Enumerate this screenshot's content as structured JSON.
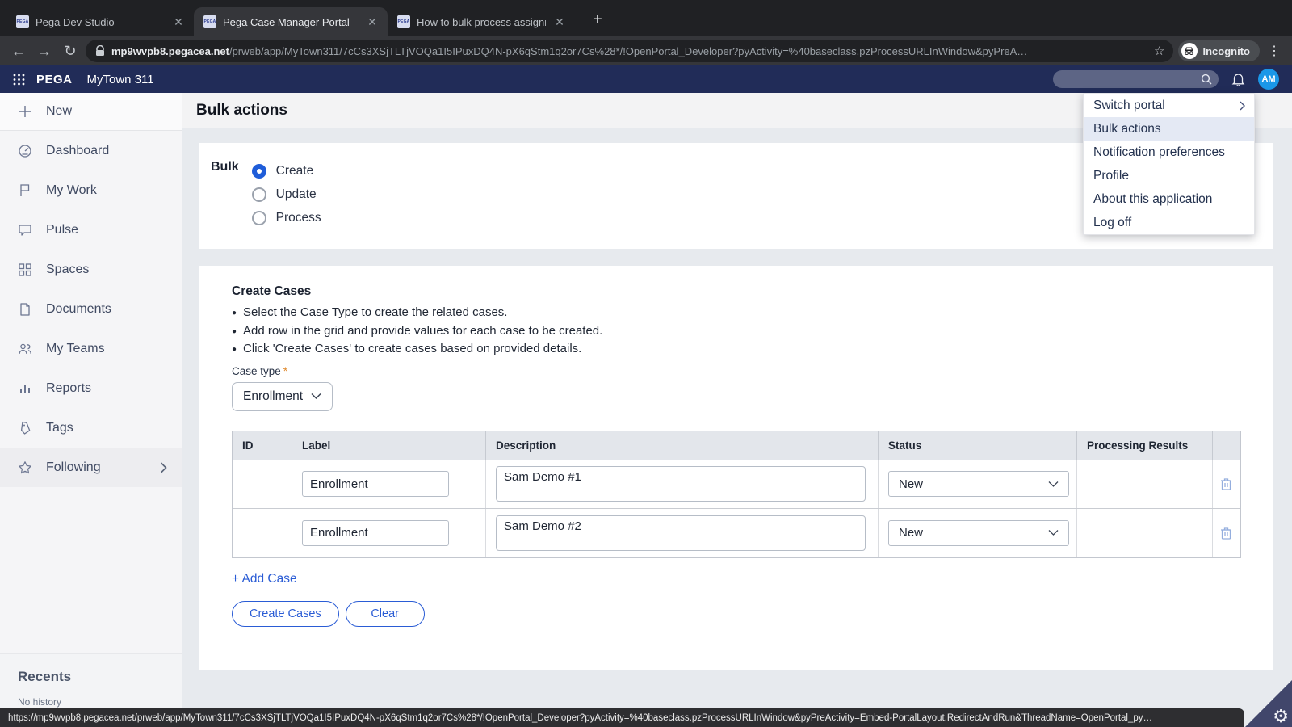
{
  "browser": {
    "tabs": [
      {
        "title": "Pega Dev Studio",
        "favicon": "PEGA"
      },
      {
        "title": "Pega Case Manager Portal",
        "favicon": "PEGA"
      },
      {
        "title": "How to bulk process assignme",
        "favicon": "PEGA"
      }
    ],
    "new_tab_label": "+",
    "back_icon": "←",
    "forward_icon": "→",
    "reload_icon": "↻",
    "url_domain": "mp9wvpb8.pegacea.net",
    "url_path": "/prweb/app/MyTown311/7cCs3XSjTLTjVOQa1I5IPuxDQ4N-pX6qStm1q2or7Cs%28*/!OpenPortal_Developer?pyActivity=%40baseclass.pzProcessURLInWindow&pyPreA…",
    "bookmark_star": "☆",
    "incognito_label": "Incognito",
    "kebab_icon": "⋮",
    "status_url": "https://mp9wvpb8.pegacea.net/prweb/app/MyTown311/7cCs3XSjTLTjVOQa1I5IPuxDQ4N-pX6qStm1q2or7Cs%28*/!OpenPortal_Developer?pyActivity=%40baseclass.pzProcessURLInWindow&pyPreActivity=Embed-PortalLayout.RedirectAndRun&ThreadName=OpenPortal_py…",
    "gear_icon": "⚙"
  },
  "app_header": {
    "brand": "PEGA",
    "app_name": "MyTown 311",
    "search_value": "",
    "avatar_initials": "AM"
  },
  "sidebar": {
    "items": [
      {
        "label": "New",
        "icon": "plus-icon"
      },
      {
        "label": "Dashboard",
        "icon": "gauge-icon"
      },
      {
        "label": "My Work",
        "icon": "flag-icon"
      },
      {
        "label": "Pulse",
        "icon": "chat-icon"
      },
      {
        "label": "Spaces",
        "icon": "grid-icon"
      },
      {
        "label": "Documents",
        "icon": "document-icon"
      },
      {
        "label": "My Teams",
        "icon": "people-icon"
      },
      {
        "label": "Reports",
        "icon": "bar-chart-icon"
      },
      {
        "label": "Tags",
        "icon": "tag-icon"
      },
      {
        "label": "Following",
        "icon": "star-icon",
        "has_chevron": true
      }
    ],
    "recents_title": "Recents",
    "recents_empty": "No history"
  },
  "user_menu": {
    "items": [
      {
        "label": "Switch portal",
        "has_submenu": true
      },
      {
        "label": "Bulk actions",
        "highlighted": true
      },
      {
        "label": "Notification preferences"
      },
      {
        "label": "Profile"
      },
      {
        "label": "About this application"
      },
      {
        "label": "Log off"
      }
    ]
  },
  "main": {
    "page_title": "Bulk actions",
    "bulk_label": "Bulk",
    "radio_options": [
      {
        "label": "Create",
        "selected": true
      },
      {
        "label": "Update",
        "selected": false
      },
      {
        "label": "Process",
        "selected": false
      }
    ],
    "create_cases": {
      "title": "Create Cases",
      "instructions": [
        "Select the Case Type to create the related cases.",
        "Add row in the grid and provide values for each case to be created.",
        "Click 'Create Cases' to create cases based on provided details."
      ],
      "case_type_label": "Case type",
      "required_marker": "*",
      "case_type_value": "Enrollment",
      "table": {
        "columns": [
          "ID",
          "Label",
          "Description",
          "Status",
          "Processing Results",
          ""
        ],
        "rows": [
          {
            "id": "",
            "label": "Enrollment",
            "description": "Sam Demo #1",
            "status": "New",
            "processing_results": ""
          },
          {
            "id": "",
            "label": "Enrollment",
            "description": "Sam Demo #2",
            "status": "New",
            "processing_results": ""
          }
        ]
      },
      "add_case_label": "+ Add Case",
      "create_button": "Create Cases",
      "clear_button": "Clear"
    }
  },
  "colors": {
    "pega_navy": "#212c58",
    "accent_blue": "#2a5cd5",
    "radio_blue": "#1f5dd9",
    "avatar_blue": "#1a97e8",
    "menu_highlight": "#e4e9f4",
    "page_bg": "#e7eaee",
    "chrome_dark": "#202124",
    "chrome_toolbar": "#35363a"
  }
}
